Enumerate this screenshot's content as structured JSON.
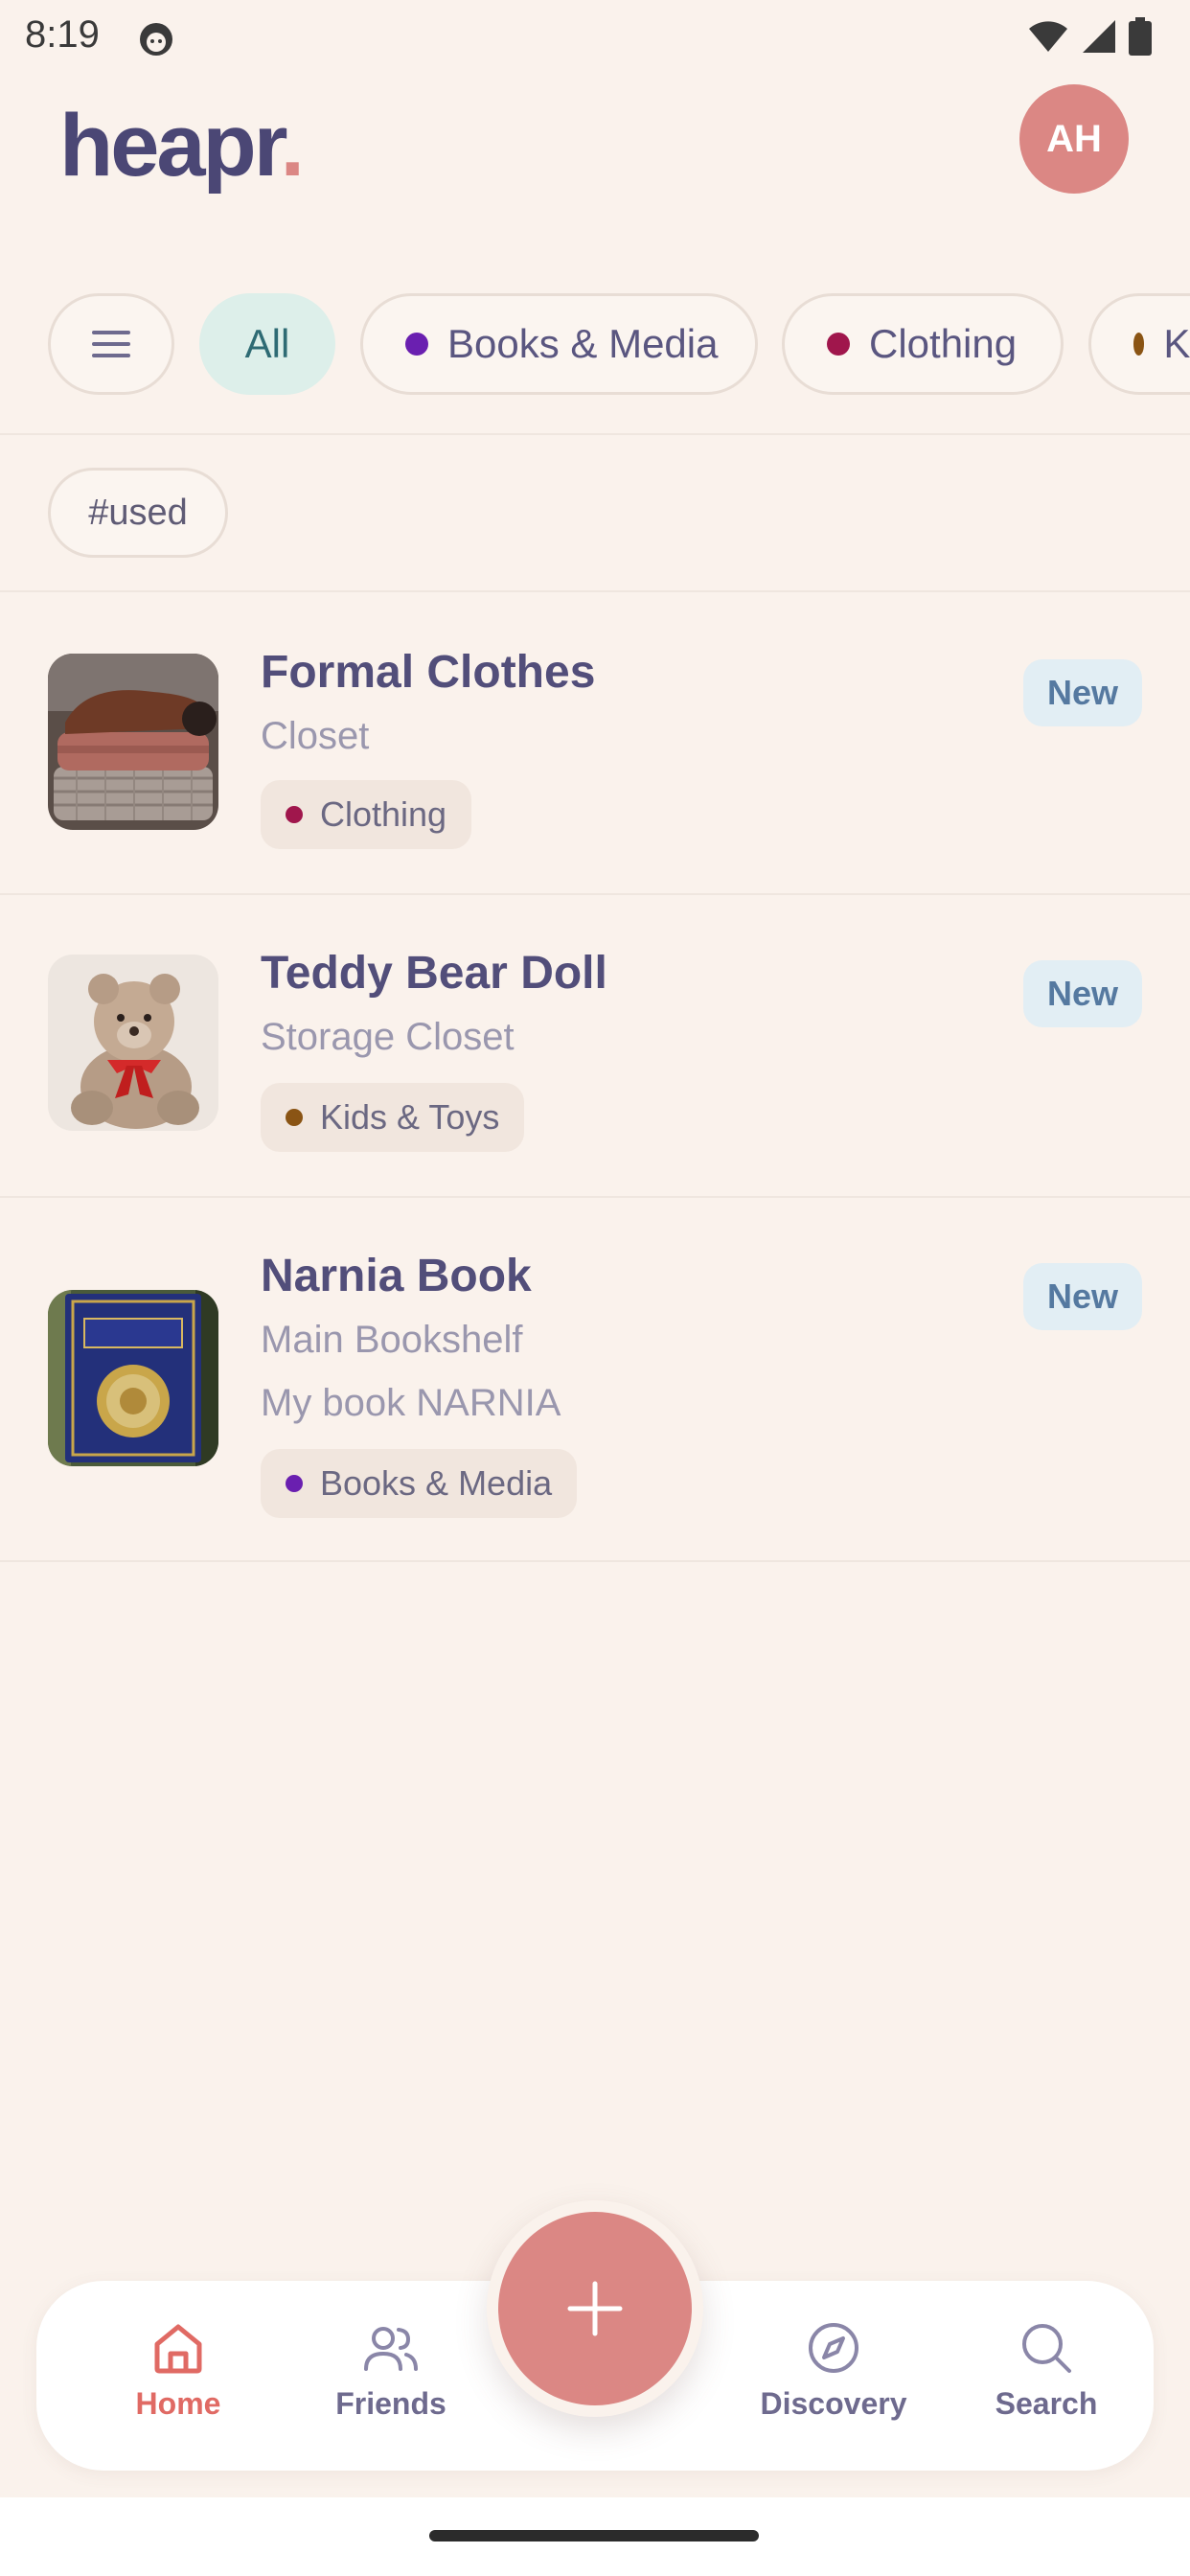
{
  "status_bar": {
    "time": "8:19"
  },
  "header": {
    "logo_text": "heapr",
    "logo_dot": ".",
    "avatar_initials": "AH"
  },
  "filters": {
    "all": "All",
    "categories": [
      {
        "label": "Books & Media",
        "color": "#6A1FB0"
      },
      {
        "label": "Clothing",
        "color": "#A0164C"
      },
      {
        "label": "Kids & Toys",
        "color": "#8A5414"
      }
    ]
  },
  "tags": [
    "#used"
  ],
  "items": [
    {
      "title": "Formal Clothes",
      "location": "Closet",
      "note": "",
      "badge": "New",
      "category": "Clothing",
      "category_color": "#A0164C"
    },
    {
      "title": "Teddy Bear Doll",
      "location": "Storage Closet",
      "note": "",
      "badge": "New",
      "category": "Kids & Toys",
      "category_color": "#8A5414"
    },
    {
      "title": "Narnia Book",
      "location": "Main Bookshelf",
      "note": "My book NARNIA",
      "badge": "New",
      "category": "Books & Media",
      "category_color": "#6A1FB0"
    }
  ],
  "bottom_nav": {
    "home": "Home",
    "friends": "Friends",
    "discovery": "Discovery",
    "search": "Search"
  },
  "colors": {
    "background": "#FAF2EC",
    "accent": "#DB8784",
    "primary_text": "#4F4A72"
  }
}
